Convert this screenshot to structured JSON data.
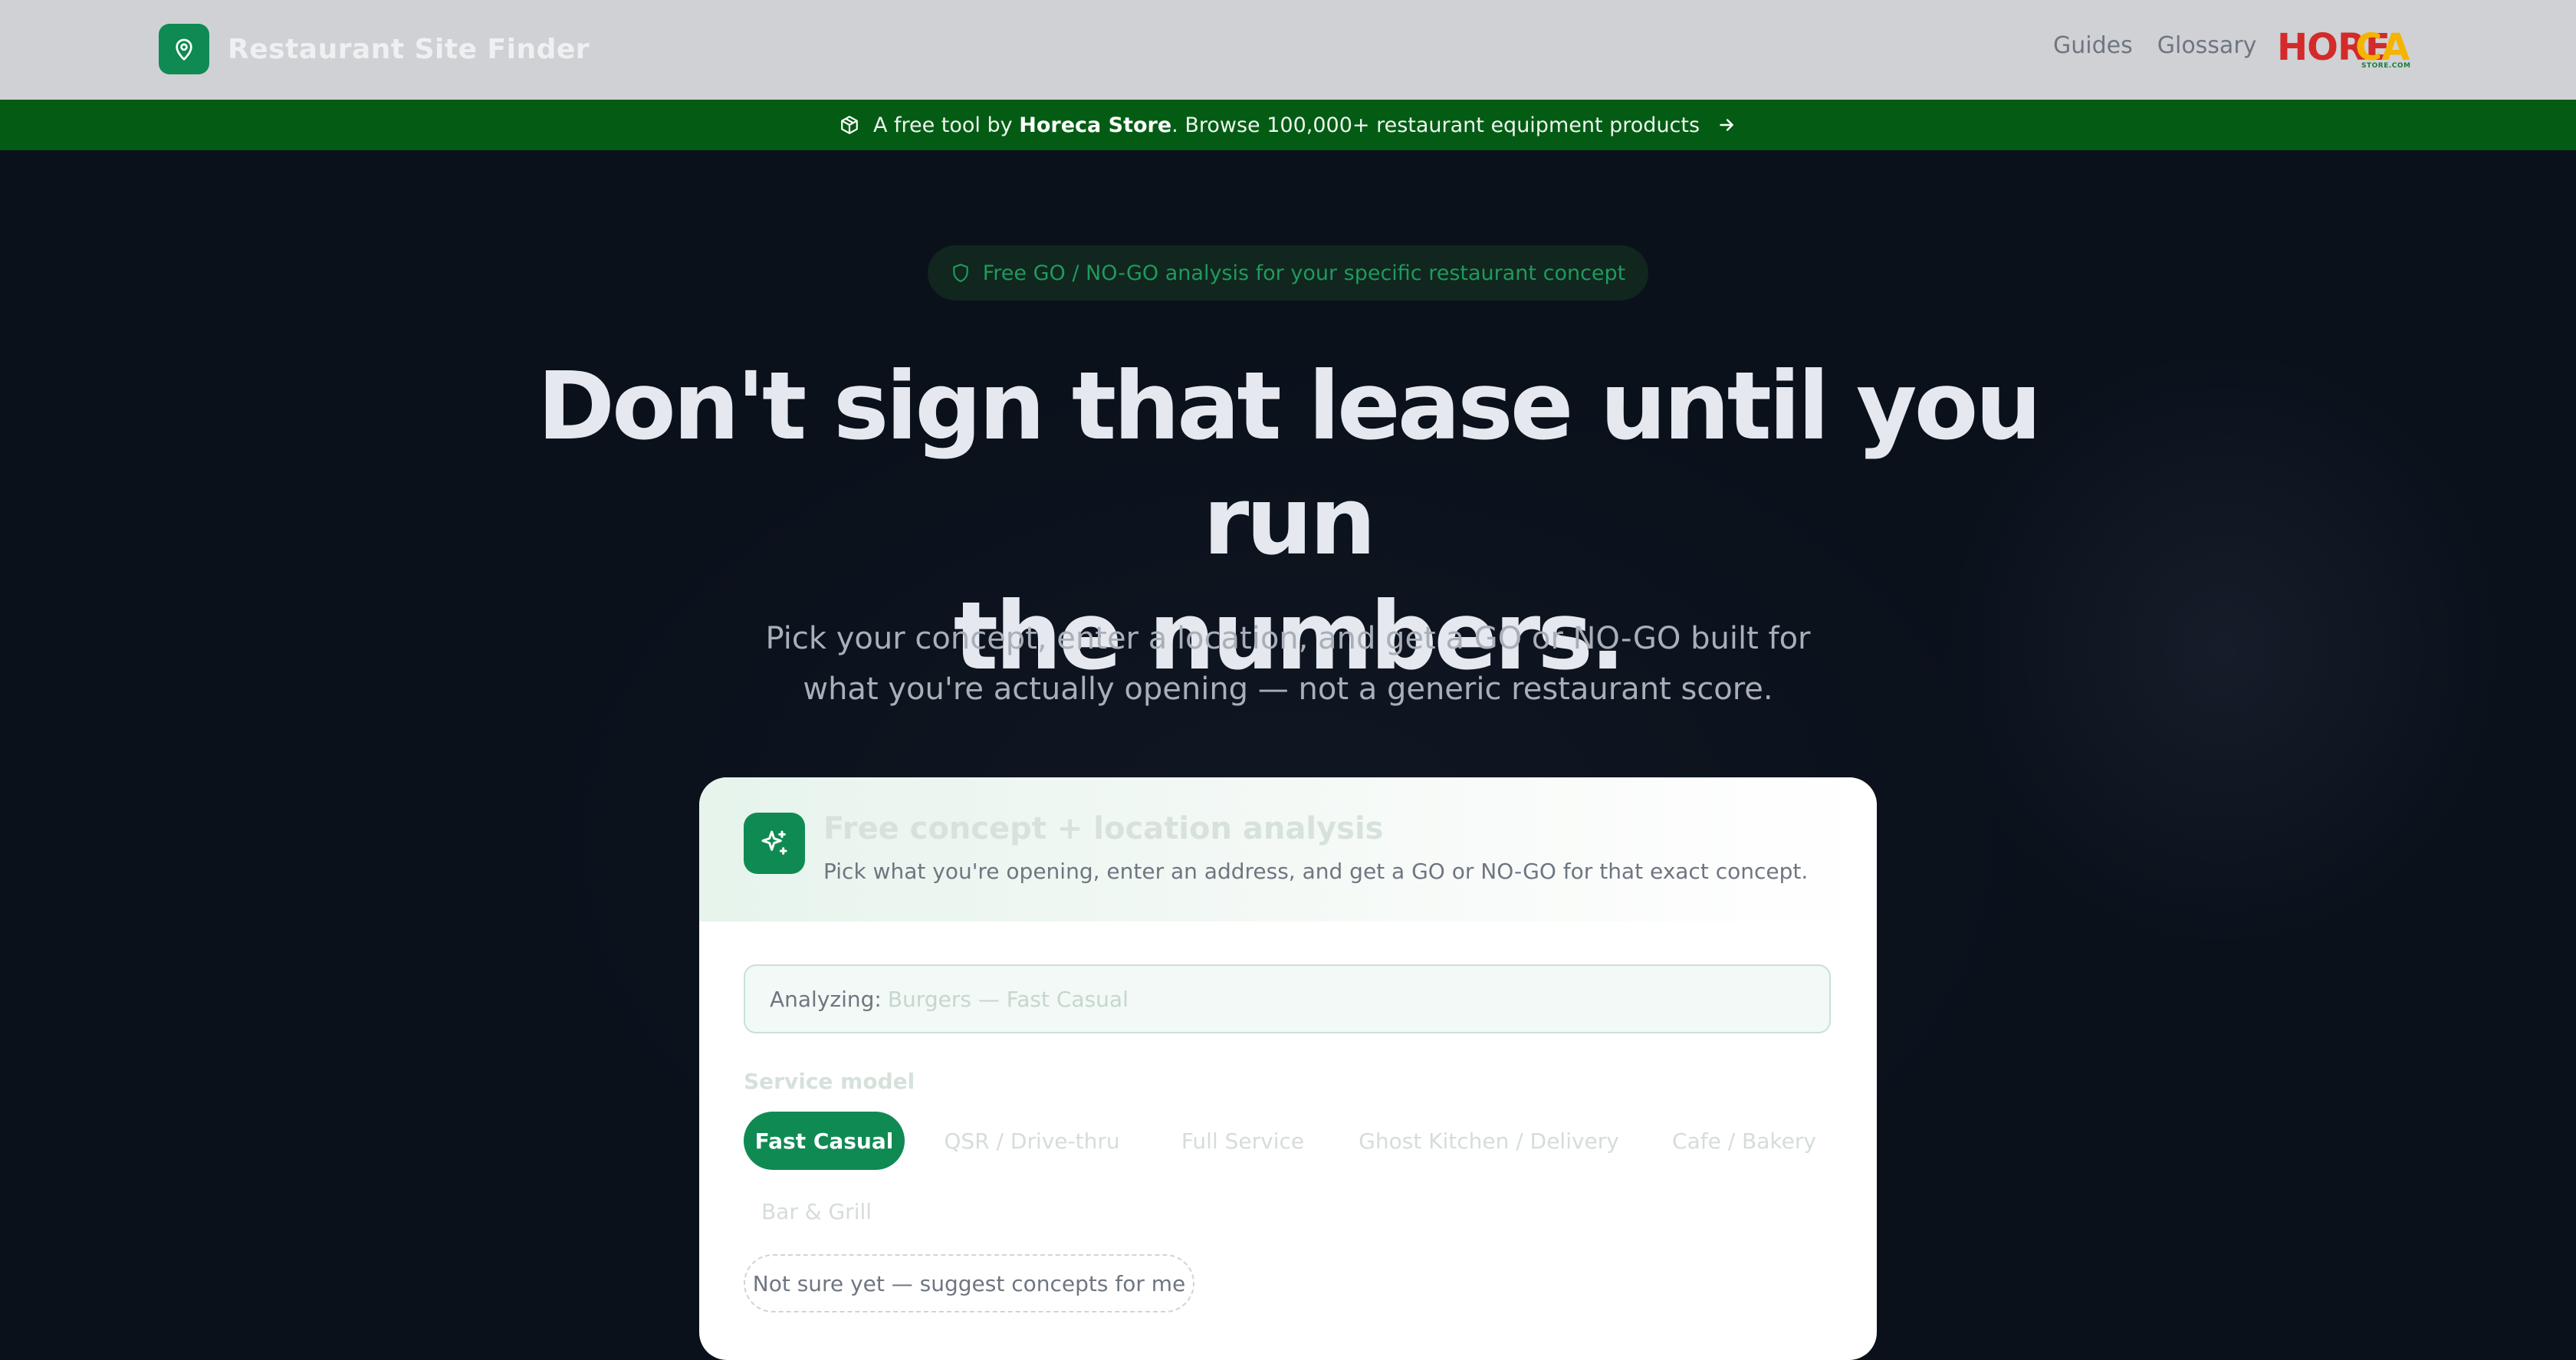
{
  "nav": {
    "brand_name": "Restaurant Site Finder",
    "links": [
      {
        "label": "Guides"
      },
      {
        "label": "Glossary"
      }
    ],
    "partner_logo_word_1": "HORE",
    "partner_logo_word_2": "CA",
    "partner_logo_sub": "STORE.COM"
  },
  "promo": {
    "prefix": "A free tool by ",
    "store_name": "Horeca Store",
    "suffix": ". Browse 100,000+ restaurant equipment products",
    "icons": [
      "package-icon",
      "arrow-right-icon"
    ]
  },
  "hero": {
    "pill_text": "Free GO / NO-GO analysis for your specific restaurant concept",
    "headline_line_1": "Don't sign that lease until you run",
    "headline_line_2": "the numbers.",
    "subhead_line_1": "Pick your concept, enter a location, and get a GO or NO-GO built for",
    "subhead_line_2": "what you're actually opening — not a generic restaurant score."
  },
  "card": {
    "title": "Free concept + location analysis",
    "description": "Pick what you're opening, enter an address, and get a GO or NO-GO for that exact concept.",
    "analyzing_label": "Analyzing:",
    "analyzing_value": "Burgers — Fast Casual",
    "service_model_label": "Service model",
    "service_models": [
      {
        "label": "Fast Casual",
        "selected": true
      },
      {
        "label": "QSR / Drive-thru",
        "selected": false
      },
      {
        "label": "Full Service",
        "selected": false
      },
      {
        "label": "Ghost Kitchen / Delivery",
        "selected": false
      },
      {
        "label": "Cafe / Bakery",
        "selected": false
      },
      {
        "label": "Bar & Grill",
        "selected": false
      }
    ],
    "suggest_label": "Not sure yet — suggest concepts for me"
  },
  "colors": {
    "accent_green": "#0f8a53",
    "promo_green": "#045c14",
    "hero_bg": "#0b111b",
    "nav_bg": "#cfd1d5"
  }
}
